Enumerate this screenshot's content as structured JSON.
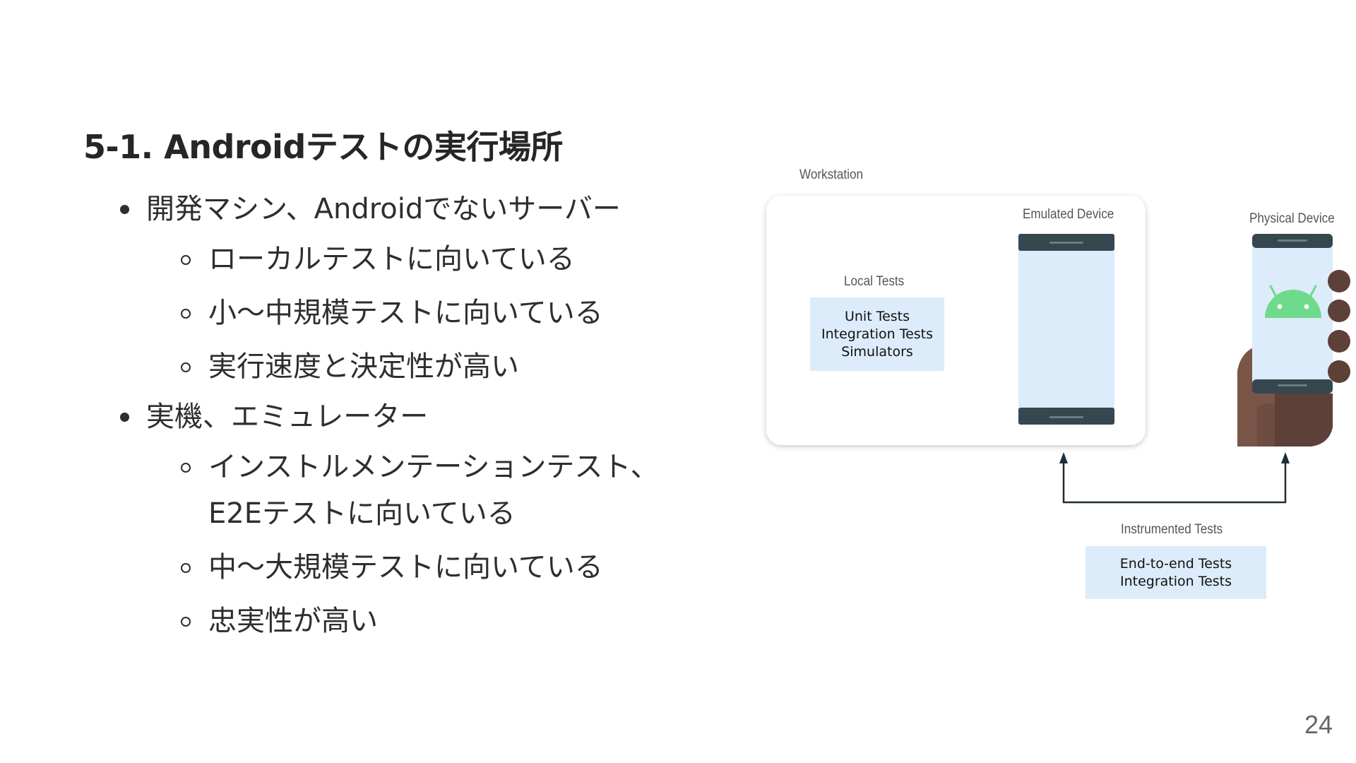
{
  "title": "5-1. Androidテストの実行場所",
  "bullets": [
    {
      "text": "開発マシン、Androidでないサーバー",
      "sub": [
        "ローカルテストに向いている",
        "小〜中規模テストに向いている",
        "実行速度と決定性が高い"
      ]
    },
    {
      "text": "実機、エミュレーター",
      "sub": [
        "インストルメンテーションテスト、E2Eテストに向いている",
        "中〜大規模テストに向いている",
        "忠実性が高い"
      ]
    }
  ],
  "diagram": {
    "workstation_label": "Workstation",
    "emulated_device_label": "Emulated Device",
    "physical_device_label": "Physical Device",
    "local_tests": {
      "label": "Local Tests",
      "items": [
        "Unit Tests",
        "Integration Tests",
        "Simulators"
      ]
    },
    "instrumented_tests": {
      "label": "Instrumented Tests",
      "items": [
        "End-to-end Tests",
        "Integration Tests"
      ]
    },
    "colors": {
      "box_fill": "#dcecfa",
      "screen_fill": "#dcecfa",
      "device_bar": "#37474f",
      "android_green": "#6fda8c",
      "hand_dark": "#5d4037",
      "hand_light": "#795548",
      "arrow": "#1f2d36"
    }
  },
  "page_number": "24"
}
